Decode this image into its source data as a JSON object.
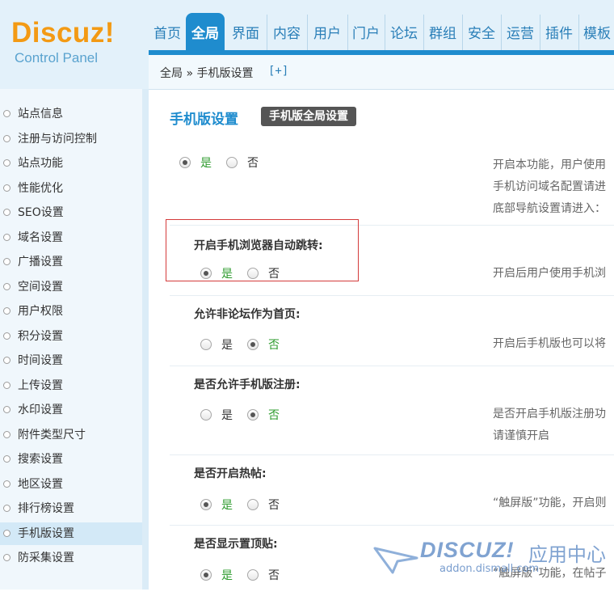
{
  "logo": {
    "brand": "Discuz!",
    "subtitle": "Control Panel"
  },
  "nav": {
    "tabs": [
      {
        "label": "首页",
        "active": false
      },
      {
        "label": "全局",
        "active": true
      },
      {
        "label": "界面",
        "active": false
      },
      {
        "label": "内容",
        "active": false
      },
      {
        "label": "用户",
        "active": false
      },
      {
        "label": "门户",
        "active": false
      },
      {
        "label": "论坛",
        "active": false
      },
      {
        "label": "群组",
        "active": false
      },
      {
        "label": "安全",
        "active": false
      },
      {
        "label": "运营",
        "active": false
      },
      {
        "label": "插件",
        "active": false
      },
      {
        "label": "模板",
        "active": false
      }
    ]
  },
  "breadcrumb": {
    "text": "全局 » 手机版设置",
    "add": "[+]"
  },
  "sidebar": {
    "items": [
      {
        "label": "站点信息"
      },
      {
        "label": "注册与访问控制"
      },
      {
        "label": "站点功能"
      },
      {
        "label": "性能优化"
      },
      {
        "label": "SEO设置"
      },
      {
        "label": "域名设置"
      },
      {
        "label": "广播设置"
      },
      {
        "label": "空间设置"
      },
      {
        "label": "用户权限"
      },
      {
        "label": "积分设置"
      },
      {
        "label": "时间设置"
      },
      {
        "label": "上传设置"
      },
      {
        "label": "水印设置"
      },
      {
        "label": "附件类型尺寸"
      },
      {
        "label": "搜索设置"
      },
      {
        "label": "地区设置"
      },
      {
        "label": "排行榜设置"
      },
      {
        "label": "手机版设置",
        "active": true
      },
      {
        "label": "防采集设置"
      }
    ]
  },
  "main": {
    "title": "手机版设置",
    "badge": "手机版全局设置",
    "settings": [
      {
        "label": "",
        "yes": "是",
        "no": "否",
        "selected": "yes",
        "desc": [
          "开启本功能，用户使用",
          "手机访问域名配置请进",
          "底部导航设置请进入："
        ]
      },
      {
        "label": "开启手机浏览器自动跳转:",
        "yes": "是",
        "no": "否",
        "selected": "yes",
        "desc": [
          "开启后用户使用手机浏"
        ]
      },
      {
        "label": "允许非论坛作为首页:",
        "yes": "是",
        "no": "否",
        "selected": "no",
        "desc": [
          "开启后手机版也可以将"
        ]
      },
      {
        "label": "是否允许手机版注册:",
        "yes": "是",
        "no": "否",
        "selected": "no",
        "desc": [
          "是否开启手机版注册功",
          "请谨慎开启"
        ]
      },
      {
        "label": "是否开启热帖:",
        "yes": "是",
        "no": "否",
        "selected": "yes",
        "desc": [
          "“触屏版”功能，开启则"
        ]
      },
      {
        "label": "是否显示置顶贴:",
        "yes": "是",
        "no": "否",
        "selected": "yes",
        "desc": [
          "“触屏版”功能，在帖子"
        ]
      }
    ]
  },
  "watermark": {
    "brand": "DISCUZ!",
    "cn": "应用中心",
    "url": "addon.dismall.com"
  },
  "colors": {
    "accent": "#1f8cce",
    "logo": "#f39a14",
    "highlight": "#d43b3b",
    "selected_text": "#2e9b2e"
  }
}
